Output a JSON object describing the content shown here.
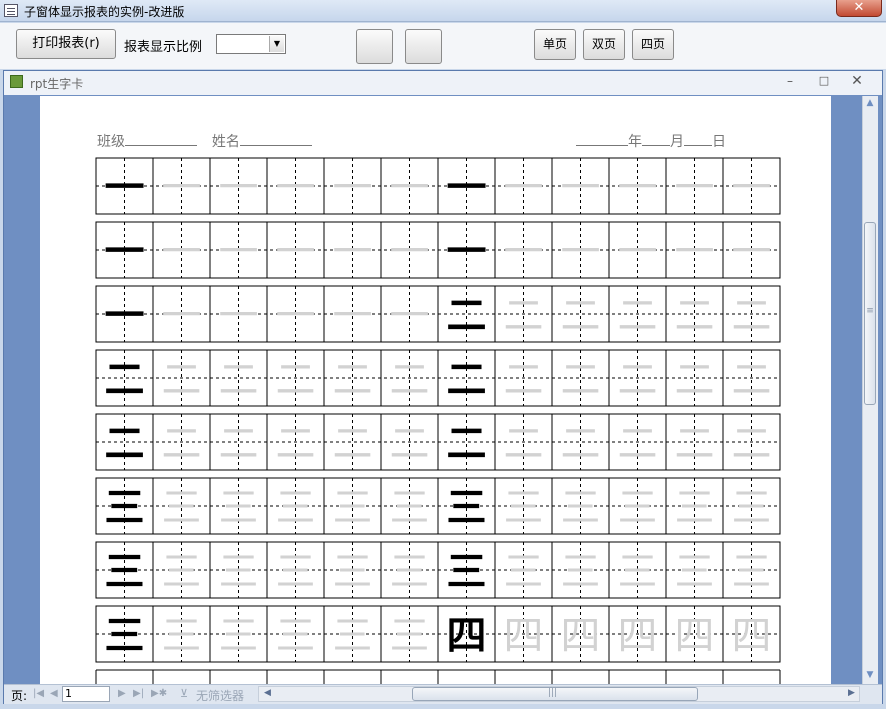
{
  "window": {
    "title": "子窗体显示报表的实例-改进版",
    "close_glyph": "✕"
  },
  "toolbar": {
    "print_label": "打印报表(r)",
    "scale_label": "报表显示比例",
    "scale_value": "",
    "single_page_label": "单页",
    "double_page_label": "双页",
    "four_page_label": "四页"
  },
  "child_window": {
    "title": "rpt生字卡",
    "min_glyph": "–",
    "max_glyph": "□",
    "close_glyph": "✕"
  },
  "report": {
    "class_label": "班级",
    "name_label": "姓名",
    "year_label": "年",
    "month_label": "月",
    "day_label": "日",
    "rows": [
      [
        "一",
        "一"
      ],
      [
        "一",
        "一"
      ],
      [
        "一",
        "二"
      ],
      [
        "二",
        "二"
      ],
      [
        "二",
        "二"
      ],
      [
        "三",
        "三"
      ],
      [
        "三",
        "三"
      ],
      [
        "三",
        "四"
      ]
    ],
    "trace_count": 5
  },
  "statusbar": {
    "page_label": "页:",
    "page_value": "1",
    "filter_label": "无筛选器",
    "nav_first": "|◀",
    "nav_prev": "◀",
    "nav_next": "▶",
    "nav_last": "▶|",
    "nav_new": "▶✱"
  },
  "icons": {
    "app": "form-icon",
    "child": "report-icon",
    "filter": "funnel-icon"
  },
  "colors": {
    "trace_char": "#d2d2d2",
    "grid_line": "#000000",
    "child_frame": "#6f8fc2"
  }
}
